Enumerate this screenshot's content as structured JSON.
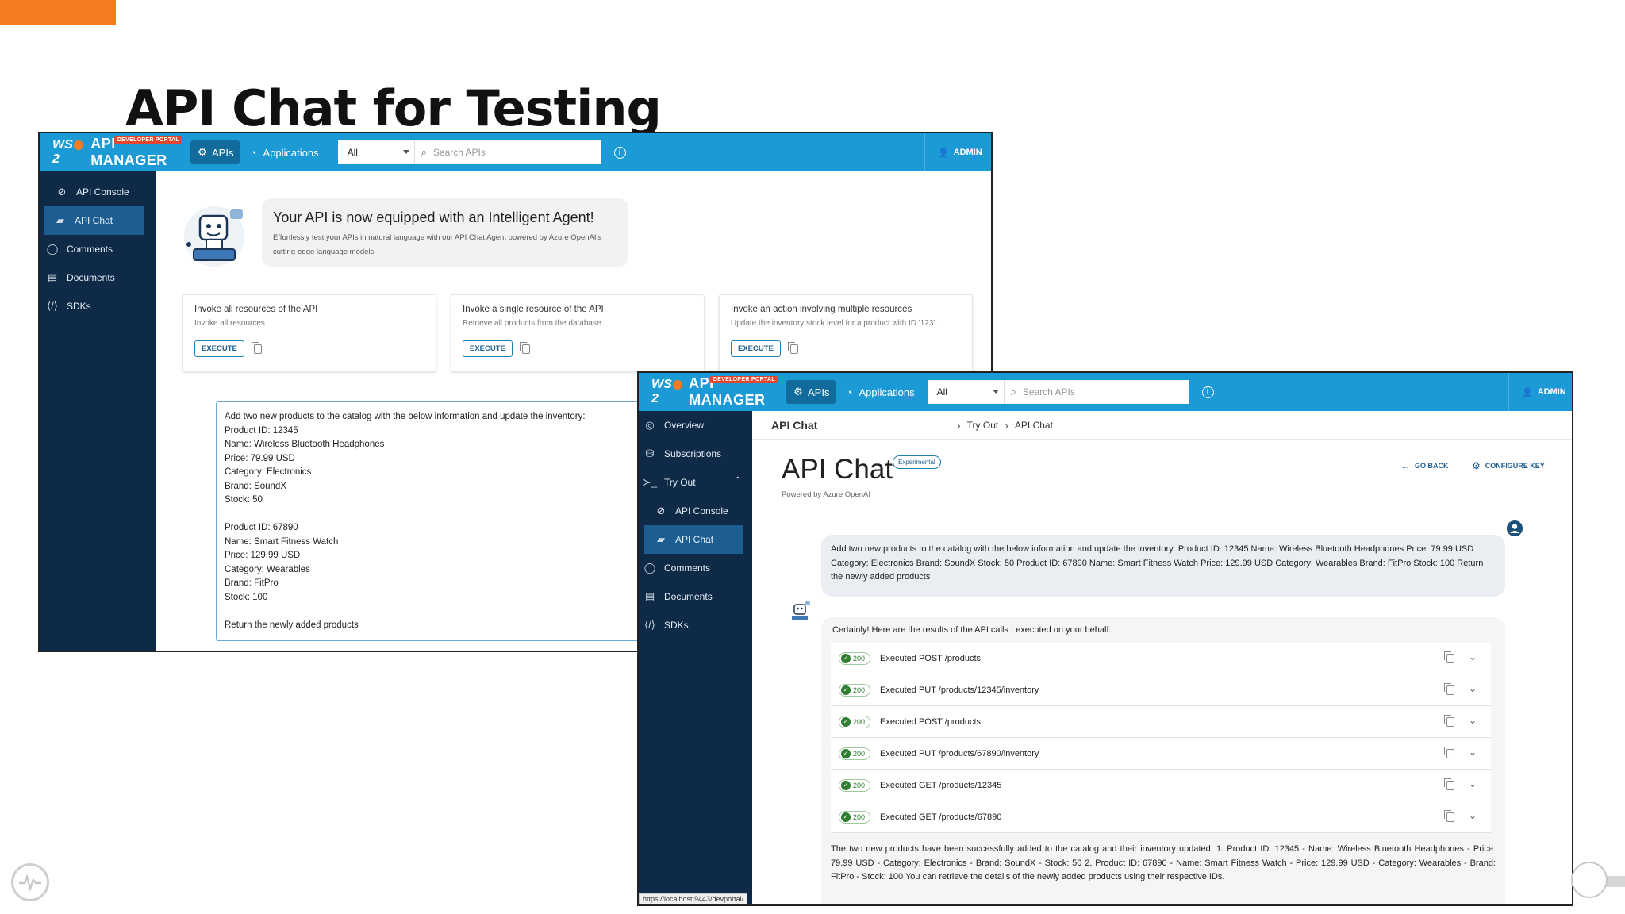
{
  "slide": {
    "title": "API Chat for Testing",
    "accent_color": "#f47b20"
  },
  "topbar": {
    "brand_wso2": "WSO2",
    "brand_name": "API MANAGER",
    "developer_portal_badge": "DEVELOPER PORTAL",
    "nav_apis": "APIs",
    "nav_applications": "Applications",
    "filter_selected": "All",
    "search_placeholder": "Search APIs",
    "user": "ADMIN",
    "bar_color": "#1c9ad6"
  },
  "window1": {
    "sidebar": [
      {
        "label": "API Console",
        "icon": "console-icon"
      },
      {
        "label": "API Chat",
        "icon": "chat-icon",
        "active": true
      },
      {
        "label": "Comments",
        "icon": "comment-icon"
      },
      {
        "label": "Documents",
        "icon": "document-icon"
      },
      {
        "label": "SDKs",
        "icon": "code-icon"
      }
    ],
    "agent_heading": "Your API is now equipped with an Intelligent Agent!",
    "agent_desc_line1": "Effortlessly test your APIs in natural language with our API Chat Agent powered by Azure OpenAI's",
    "agent_desc_line2": "cutting-edge language models.",
    "cards": [
      {
        "title": "Invoke all resources of the API",
        "subtitle": "Invoke all resources",
        "button": "EXECUTE"
      },
      {
        "title": "Invoke a single resource of the API",
        "subtitle": "Retrieve all products from the database.",
        "button": "EXECUTE"
      },
      {
        "title": "Invoke an action involving multiple resources",
        "subtitle": "Update the inventory stock level for a product with ID '123' ...",
        "button": "EXECUTE"
      }
    ],
    "prompt_text": "Add two new products to the catalog with the below information and update the inventory:\nProduct ID: 12345\nName: Wireless Bluetooth Headphones\nPrice: 79.99 USD\nCategory: Electronics\nBrand: SoundX\nStock: 50\n\nProduct ID: 67890\nName: Smart Fitness Watch\nPrice: 129.99 USD\nCategory: Wearables\nBrand: FitPro\nStock: 100\n\nReturn the newly added products"
  },
  "window2": {
    "sidebar": [
      {
        "label": "Overview",
        "icon": "overview-icon"
      },
      {
        "label": "Subscriptions",
        "icon": "subscriptions-icon"
      },
      {
        "label": "Try Out",
        "icon": "terminal-icon",
        "expanded": true
      },
      {
        "label": "API Console",
        "icon": "console-icon",
        "sub": true
      },
      {
        "label": "API Chat",
        "icon": "chat-icon",
        "sub": true,
        "active": true
      },
      {
        "label": "Comments",
        "icon": "comment-icon"
      },
      {
        "label": "Documents",
        "icon": "document-icon"
      },
      {
        "label": "SDKs",
        "icon": "code-icon"
      }
    ],
    "breadcrumb_title": "API Chat",
    "breadcrumb_1": "Try Out",
    "breadcrumb_2": "API Chat",
    "page_title": "API Chat",
    "badge": "Experimental",
    "powered_by": "Powered by Azure OpenAI",
    "go_back": "GO BACK",
    "configure_key": "CONFIGURE KEY",
    "user_message": "Add two new products to the catalog with the below information and update the inventory: Product ID: 12345 Name: Wireless Bluetooth Headphones Price: 79.99 USD Category: Electronics Brand: SoundX Stock: 50 Product ID: 67890 Name: Smart Fitness Watch Price: 129.99 USD Category: Wearables Brand: FitPro Stock: 100 Return the newly added products",
    "bot_intro": "Certainly! Here are the results of the API calls I executed on your behalf:",
    "executions": [
      {
        "status": "200",
        "text": "Executed POST /products"
      },
      {
        "status": "200",
        "text": "Executed PUT /products/12345/inventory"
      },
      {
        "status": "200",
        "text": "Executed POST /products"
      },
      {
        "status": "200",
        "text": "Executed PUT /products/67890/inventory"
      },
      {
        "status": "200",
        "text": "Executed GET /products/12345"
      },
      {
        "status": "200",
        "text": "Executed GET /products/67890"
      }
    ],
    "bot_summary": "The two new products have been successfully added to the catalog and their inventory updated: 1. Product ID: 12345 - Name: Wireless Bluetooth Headphones - Price: 79.99 USD - Category: Electronics - Brand: SoundX - Stock: 50 2. Product ID: 67890 - Name: Smart Fitness Watch - Price: 129.99 USD - Category: Wearables - Brand: FitPro - Stock: 100 You can retrieve the details of the newly added products using their respective IDs.",
    "status_url": "https://localhost:9443/devportal/"
  }
}
